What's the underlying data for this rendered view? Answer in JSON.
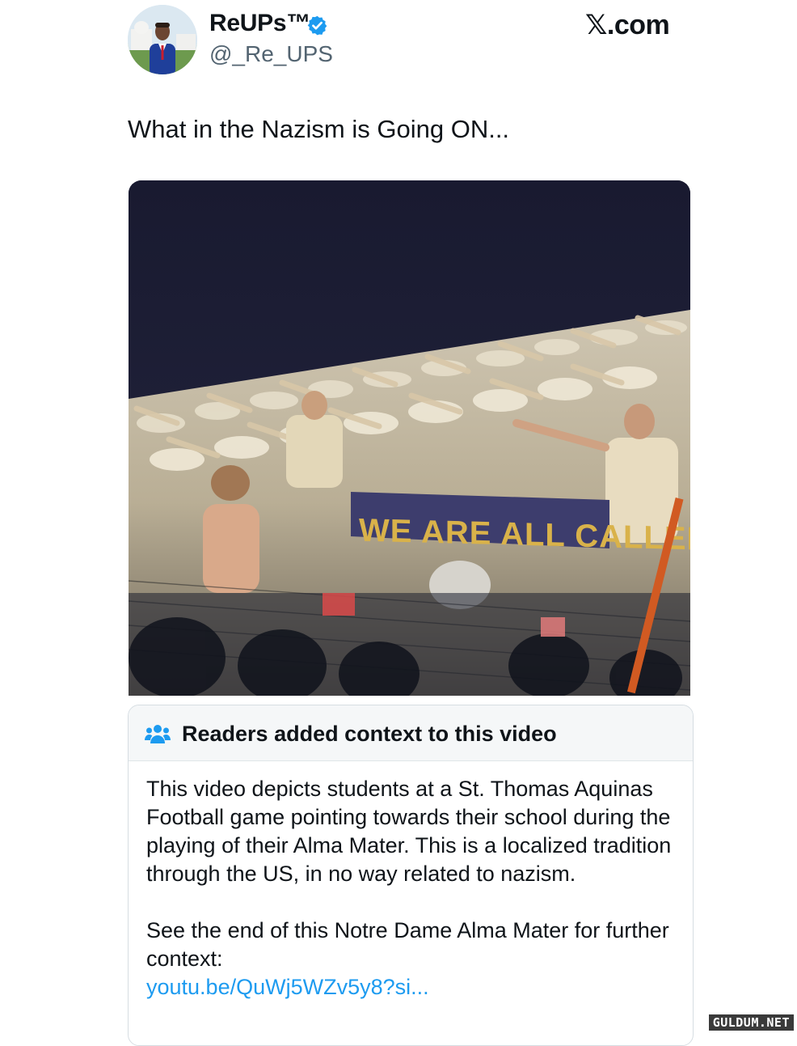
{
  "tweet": {
    "display_name": "ReUPs™",
    "handle": "@_Re_UPS",
    "source_label": "𝕏.com",
    "text": "What in the Nazism is Going ON...",
    "verified": true
  },
  "media": {
    "type": "video",
    "banner_text": "WE ARE ALL CALLED"
  },
  "community_note": {
    "title": "Readers added context to this video",
    "body_p1": "This video depicts students at a St. Thomas Aquinas Football game pointing towards their school during the playing of their Alma Mater. This is a localized tradition through the US, in no way related to nazism.",
    "body_p2": "See the end of this Notre Dame Alma Mater for further context:",
    "link": "youtu.be/QuWj5WZv5y8?si..."
  },
  "watermark": "GULDUM.NET",
  "colors": {
    "link": "#1d9bf0",
    "verified": "#1d9bf0",
    "secondary_text": "#536471",
    "night_sky": "#1b1d33"
  }
}
